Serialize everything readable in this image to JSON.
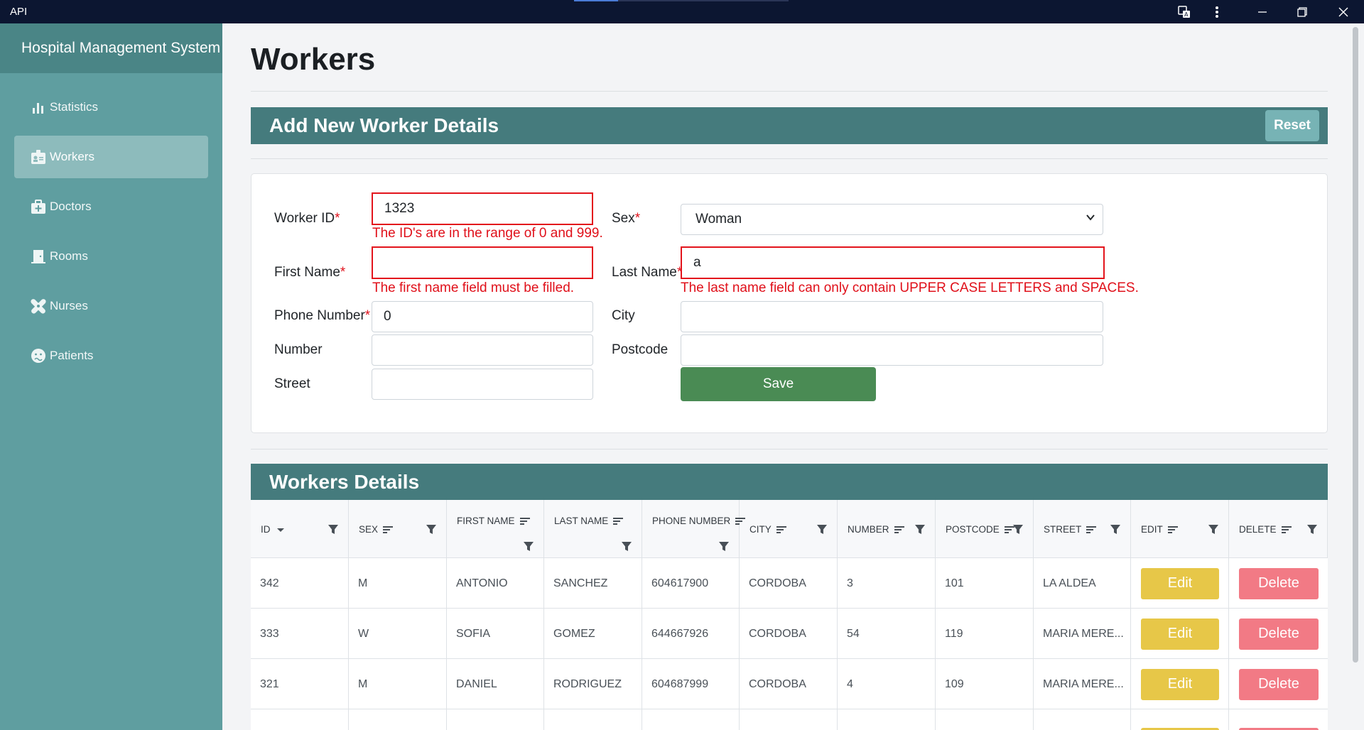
{
  "window": {
    "title": "API"
  },
  "sidebar": {
    "brand": "Hospital Management System",
    "items": [
      {
        "label": "Statistics",
        "icon": "bar-chart-icon",
        "active": false
      },
      {
        "label": "Workers",
        "icon": "id-badge-icon",
        "active": true
      },
      {
        "label": "Doctors",
        "icon": "medical-kit-icon",
        "active": false
      },
      {
        "label": "Rooms",
        "icon": "door-icon",
        "active": false
      },
      {
        "label": "Nurses",
        "icon": "bandage-icon",
        "active": false
      },
      {
        "label": "Patients",
        "icon": "sick-face-icon",
        "active": false
      }
    ]
  },
  "page": {
    "title": "Workers"
  },
  "form": {
    "header": "Add New Worker Details",
    "reset_label": "Reset",
    "required_mark": "*",
    "worker_id": {
      "label": "Worker ID",
      "value": "1323",
      "error": "The ID's are in the range of 0 and 999."
    },
    "sex": {
      "label": "Sex",
      "value": "Woman"
    },
    "first_name": {
      "label": "First Name",
      "value": "",
      "error": "The first name field must be filled."
    },
    "last_name": {
      "label": "Last Name",
      "value": "a",
      "error": "The last name field can only contain UPPER CASE LETTERS and SPACES."
    },
    "phone": {
      "label": "Phone Number",
      "value": "0"
    },
    "city": {
      "label": "City",
      "value": ""
    },
    "number": {
      "label": "Number",
      "value": ""
    },
    "postcode": {
      "label": "Postcode",
      "value": ""
    },
    "street": {
      "label": "Street",
      "value": ""
    },
    "save_label": "Save"
  },
  "table": {
    "header": "Workers Details",
    "columns": [
      "ID",
      "SEX",
      "FIRST NAME",
      "LAST NAME",
      "PHONE NUMBER",
      "CITY",
      "NUMBER",
      "POSTCODE",
      "STREET",
      "EDIT",
      "DELETE"
    ],
    "rows": [
      {
        "id": "342",
        "sex": "M",
        "first": "ANTONIO",
        "last": "SANCHEZ",
        "phone": "604617900",
        "city": "CORDOBA",
        "number": "3",
        "postcode": "101",
        "street": "LA ALDEA"
      },
      {
        "id": "333",
        "sex": "W",
        "first": "SOFIA",
        "last": "GOMEZ",
        "phone": "644667926",
        "city": "CORDOBA",
        "number": "54",
        "postcode": "119",
        "street": "MARIA MERE..."
      },
      {
        "id": "321",
        "sex": "M",
        "first": "DANIEL",
        "last": "RODRIGUEZ",
        "phone": "604687999",
        "city": "CORDOBA",
        "number": "4",
        "postcode": "109",
        "street": "MARIA MERE..."
      }
    ],
    "edit_label": "Edit",
    "delete_label": "Delete",
    "partial_edit_label": "Edit",
    "partial_delete_label": "Delete"
  },
  "colors": {
    "sidebar": "#5f9ea0",
    "brand": "#4a8586",
    "section_header": "#457b7d",
    "save": "#4a8b54",
    "edit": "#e7c748",
    "delete": "#f27a85",
    "error": "#e3141c"
  }
}
